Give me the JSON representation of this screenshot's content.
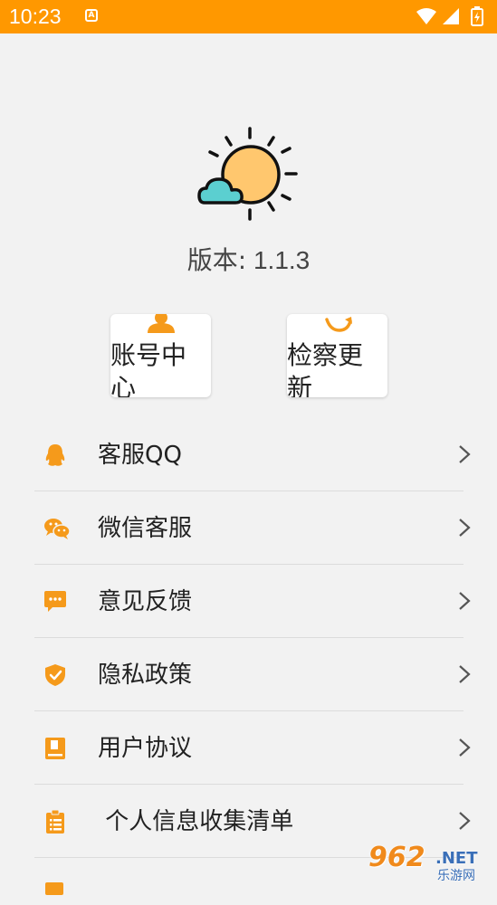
{
  "status_bar": {
    "time": "10:23",
    "notification_icon": "A",
    "icons": [
      "wifi-icon",
      "signal-icon",
      "battery-charging-icon"
    ],
    "background": "#ff9800"
  },
  "app": {
    "logo_icon": "sun-cloud-icon",
    "version_label": "版本:",
    "version_value": "1.1.3"
  },
  "cards": [
    {
      "label": "账号中心",
      "icon": "user-icon"
    },
    {
      "label": "检察更新",
      "icon": "refresh-icon"
    }
  ],
  "menu": [
    {
      "label": "客服QQ",
      "icon": "qq-icon"
    },
    {
      "label": "微信客服",
      "icon": "wechat-icon"
    },
    {
      "label": "意见反馈",
      "icon": "feedback-icon"
    },
    {
      "label": "隐私政策",
      "icon": "shield-icon"
    },
    {
      "label": "用户协议",
      "icon": "book-icon"
    },
    {
      "label": " 个人信息收集清单",
      "icon": "clipboard-icon"
    }
  ],
  "watermark": {
    "number": "962",
    "domain": ".NET",
    "site_name": "乐游网"
  },
  "colors": {
    "accent": "#ff9800",
    "icon": "#f59a1b",
    "divider": "#dcdcdc"
  }
}
